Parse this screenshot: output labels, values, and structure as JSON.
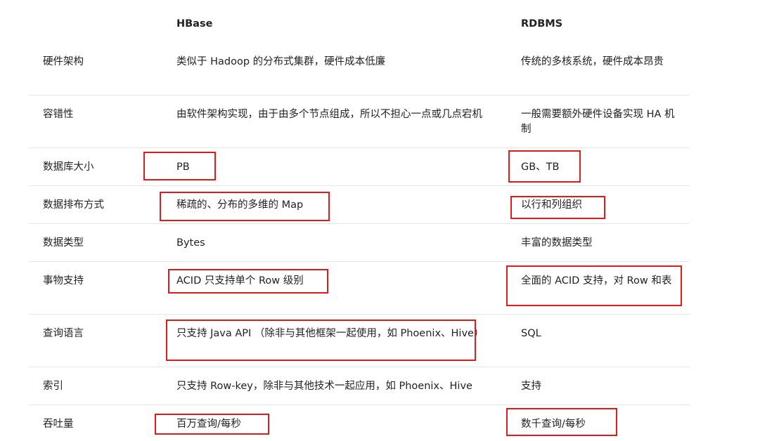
{
  "header": {
    "col1": "HBase",
    "col2": "RDBMS"
  },
  "rows": [
    {
      "label": "硬件架构",
      "hbase": "类似于 Hadoop 的分布式集群，硬件成本低廉",
      "rdbms": "传统的多核系统，硬件成本昂贵"
    },
    {
      "label": "容错性",
      "hbase": "由软件架构实现，由于由多个节点组成，所以不担心一点或几点宕机",
      "rdbms": "一般需要额外硬件设备实现 HA 机制"
    },
    {
      "label": "数据库大小",
      "hbase": "PB",
      "rdbms": "GB、TB"
    },
    {
      "label": "数据排布方式",
      "hbase": "稀疏的、分布的多维的 Map",
      "rdbms": "以行和列组织"
    },
    {
      "label": "数据类型",
      "hbase": "Bytes",
      "rdbms": "丰富的数据类型"
    },
    {
      "label": "事物支持",
      "hbase": "ACID 只支持单个 Row 级别",
      "rdbms": "全面的 ACID 支持，对 Row 和表"
    },
    {
      "label": "查询语言",
      "hbase": "只支持 Java API （除非与其他框架一起使用，如 Phoenix、Hive）",
      "rdbms": "SQL"
    },
    {
      "label": "索引",
      "hbase": "只支持 Row-key，除非与其他技术一起应用，如 Phoenix、Hive",
      "rdbms": "支持"
    },
    {
      "label": "吞吐量",
      "hbase": "百万查询/每秒",
      "rdbms": "数千查询/每秒"
    }
  ],
  "highlight_color": "#e01b1b"
}
